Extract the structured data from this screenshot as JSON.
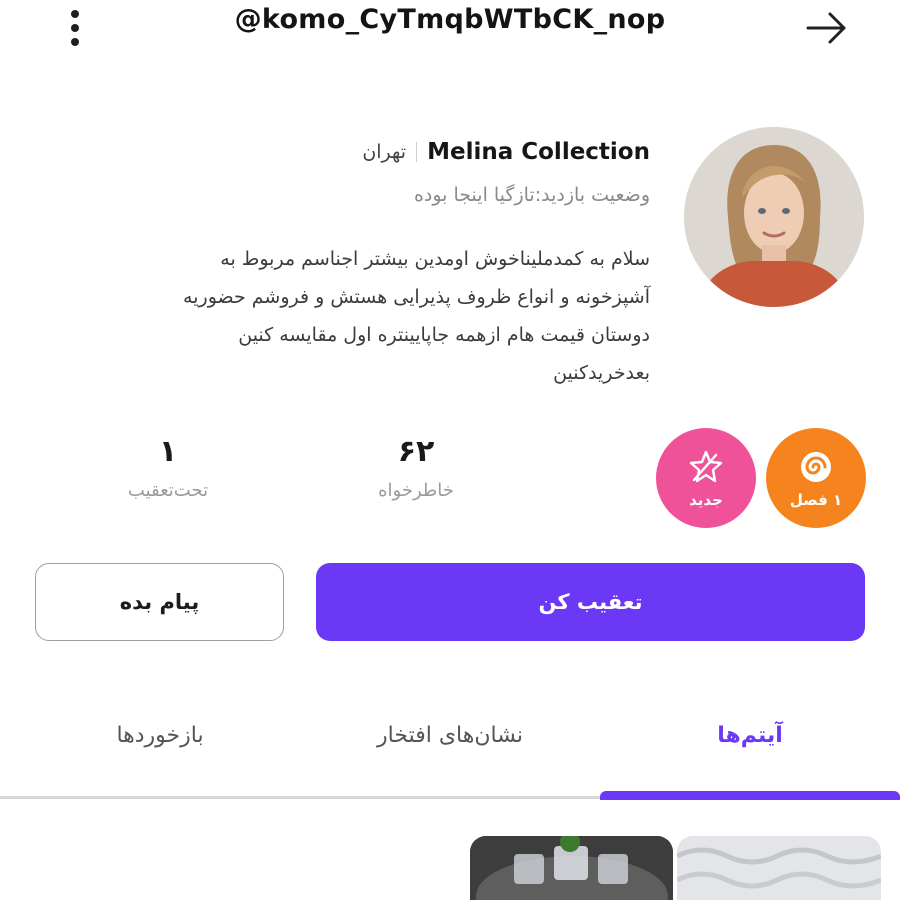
{
  "header": {
    "username": "@komo_CyTmqbWTbCK_nop"
  },
  "profile": {
    "shop_name": "Melina Collection",
    "city": "تهران",
    "visit_status": "وضعیت بازدید:تازگیا اینجا بوده",
    "bio_lines": [
      "سلام به کمدملیناخوش اومدین بیشتر اجناسم مربوط به",
      "آشپزخونه و انواع ظروف پذیرایی هستش و فروشم حضوریه",
      "دوستان قیمت هام ازهمه جاپایینتره اول مقایسه کنین",
      "بعدخریدکنین"
    ]
  },
  "stats": {
    "likes": {
      "value": "۶۲",
      "label": "خاطرخواه"
    },
    "following": {
      "value": "۱",
      "label": "تحت‌تعقیب"
    }
  },
  "badges": {
    "new": {
      "label": "جدید",
      "icon": "star-sparkle-icon",
      "color": "#f0529a"
    },
    "season": {
      "label": "۱ فصل",
      "icon": "spiral-icon",
      "color": "#f5841f"
    }
  },
  "actions": {
    "follow_label": "تعقیب کن",
    "message_label": "پیام بده"
  },
  "tabs": [
    {
      "label": "آیتم‌ها",
      "active": true
    },
    {
      "label": "نشان‌های افتخار",
      "active": false
    },
    {
      "label": "بازخوردها",
      "active": false
    }
  ],
  "colors": {
    "accent": "#6b38f5"
  }
}
